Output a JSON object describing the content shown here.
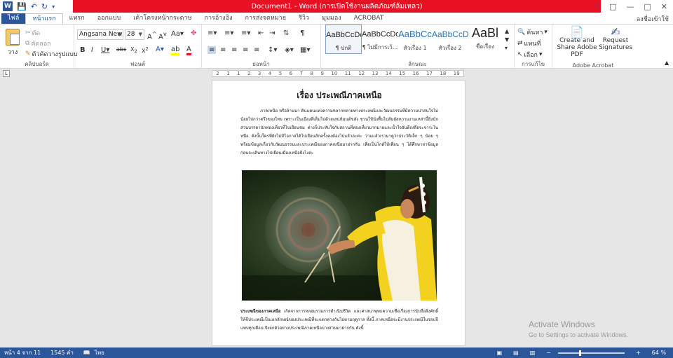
{
  "window": {
    "title": "Document1 - Word (การเปิดใช้งานผลิตภัณฑ์ล้มเหลว)",
    "signin": "ลงชื่อเข้าใช้"
  },
  "tabs": [
    "ไฟล์",
    "หน้าแรก",
    "แทรก",
    "ออกแบบ",
    "เค้าโครงหน้ากระดาษ",
    "การอ้างอิง",
    "การส่งจดหมาย",
    "รีวิว",
    "มุมมอง",
    "ACROBAT"
  ],
  "ribbon": {
    "clipboard": {
      "paste": "วาง",
      "cut": "ตัด",
      "copy": "คัดลอก",
      "format_painter": "ตัวคัดวางรูปแบบ",
      "label": "คลิปบอร์ด"
    },
    "font": {
      "name": "Angsana New",
      "size": "28",
      "label": "ฟอนต์"
    },
    "paragraph": {
      "label": "ย่อหน้า"
    },
    "styles": {
      "items": [
        {
          "sample": "AaBbCcDc",
          "name": "¶ ปกติ"
        },
        {
          "sample": "AaBbCcDc",
          "name": "¶ ไม่มีการเว้..."
        },
        {
          "sample": "AaBbCc",
          "name": "หัวเรื่อง 1"
        },
        {
          "sample": "AaBbCcD",
          "name": "หัวเรื่อง 2"
        },
        {
          "sample": "AaBl",
          "name": "ชื่อเรื่อง"
        }
      ],
      "label": "ลักษณะ"
    },
    "editing": {
      "find": "ค้นหา",
      "replace": "แทนที่",
      "select": "เลือก",
      "label": "การแก้ไข"
    },
    "acrobat": {
      "create_pdf": "Create and Share Adobe PDF",
      "request_sig": "Request Signatures",
      "label": "Adobe Acrobat"
    }
  },
  "ruler": [
    "2",
    "1",
    "1",
    "2",
    "3",
    "4",
    "5",
    "6",
    "7",
    "8",
    "9",
    "10",
    "11",
    "12",
    "13",
    "14",
    "15",
    "16",
    "17",
    "18",
    "19"
  ],
  "document": {
    "title": "เรื่อง ประเพณีภาคเหนือ",
    "para1": "ภาคเหนือ หรือล้านนา ดินแดนแห่งความหลากหลายทางประเพณีและวัฒนธรรมที่มีความน่าสนใจไม่น้อยไปกว่าครึ่งของไทย เพราะเป็นเมืองที่เต็มไปด้วยเสน่ห์มนต์ขลัง ชวนให้นั่งพื้นไปสัมผัสความงามเหล่านี้ยิ่งนัก ส่วนบรรดานักท่องเที่ยวที่ไปเยือนชม ต่างก็ประทับใจกับสถานที่ท่องเที่ยวมากมายและน้ำใจอันดีเหลือจะจาระไนหนือ ดังนั้นใครที่ยังไม่มีโอกาสได้ไปเยือนสักครั้งคงต้องไปแล้วล่ะค่ะ ว่ามแล้วเรามาดูว่าประวัติเล็ก ๆ น้อย ๆ พร้อมข้อมูลเกี่ยวกับวัฒนธรรมและประเพณีของภาคเหนือมาฝากกัน เพื่อเป็นไกด์ให้เพื่อน ๆ ได้ศึกษาหาข้อมูลก่อนจะเดินทางไปเยือนเมืองเหนือยิ่งไงล่ะ",
    "para2_bold": "ประเพณีของภาคเหนือ",
    "para2": " เกิดจากการหลอมรวมการดำเนินชีวิต และศาสนาพุทธความเชื่อเรื่องการนับถือสิ่งศักดิ์ให้ชีประเพณีเป็นเอกลักษณ์ของประเพณีที่จะแตกต่างกันไปตามฤดูกาล ทั้งนี้ ภาคเหนือจะมีงานประเพณีในรอบปีแทบทุกเดือน จึงยกตัวอย่างประเพณีภาคเหนือบางส่วนมาฝากกัน ดังนี้"
  },
  "activate": {
    "line1": "Activate Windows",
    "line2": "Go to Settings to activate Windows."
  },
  "status": {
    "page": "หน้า 4 จาก 11",
    "words": "1545 คำ",
    "lang": "ไทย",
    "zoom": "64 %"
  },
  "colors": {
    "word_blue": "#2b579a",
    "title_red": "#e81123"
  }
}
